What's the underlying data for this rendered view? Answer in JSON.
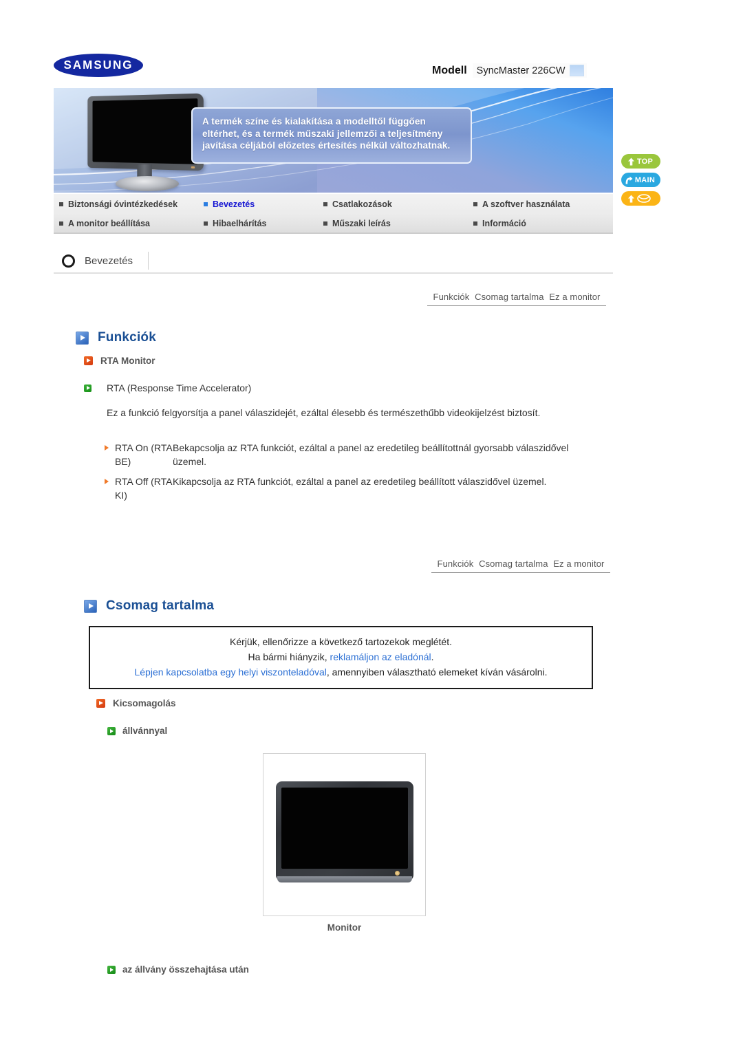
{
  "brand": {
    "logo_text": "SAMSUNG"
  },
  "model": {
    "label": "Modell",
    "value": "SyncMaster 226CW"
  },
  "banner": {
    "note": "A termék színe és kialakítása a modelltől függően eltérhet, és a termék műszaki jellemzői a teljesítmény javítása céljából előzetes értesítés nélkül változhatnak."
  },
  "side_buttons": [
    {
      "label": "TOP",
      "icon": "arrow-up-icon",
      "color": "#9ac63c"
    },
    {
      "label": "MAIN",
      "icon": "arrow-branch-icon",
      "color": "#2aa8e0"
    },
    {
      "label": "",
      "icon": "arrow-up-mail-icon",
      "color": "#fbb416"
    }
  ],
  "nav": {
    "items": [
      {
        "label": "Biztonsági óvintézkedések",
        "active": false
      },
      {
        "label": "Bevezetés",
        "active": true
      },
      {
        "label": "Csatlakozások",
        "active": false
      },
      {
        "label": "A szoftver használata",
        "active": false
      },
      {
        "label": "A monitor beállítása",
        "active": false
      },
      {
        "label": "Hibaelhárítás",
        "active": false
      },
      {
        "label": "Műszaki leírás",
        "active": false
      },
      {
        "label": "Információ",
        "active": false
      }
    ]
  },
  "section": {
    "title": "Bevezetés"
  },
  "subnav": {
    "items": [
      "Funkciók",
      "Csomag tartalma",
      "Ez a monitor"
    ]
  },
  "funkciok": {
    "heading": "Funkciók",
    "sub_heading": "RTA Monitor",
    "rta_title": "RTA (Response Time Accelerator)",
    "rta_paragraph": "Ez a funkció felgyorsítja a panel válaszidejét, ezáltal élesebb és természethűbb videokijelzést biztosít.",
    "rta_rows": [
      {
        "key": "RTA On (RTA BE)",
        "value": "Bekapcsolja az RTA funkciót, ezáltal a panel az eredetileg beállítottnál gyorsabb válaszidővel üzemel."
      },
      {
        "key": "RTA Off (RTA KI)",
        "value": "Kikapcsolja az RTA funkciót, ezáltal a panel az eredetileg beállított válaszidővel üzemel."
      }
    ]
  },
  "csomag": {
    "heading": "Csomag tartalma",
    "notice": {
      "line1": "Kérjük, ellenőrizze a következő tartozekok meglétét.",
      "line2_prefix": "Ha bármi hiányzik, ",
      "line2_link": "reklamáljon az eladónál",
      "line2_suffix": ".",
      "line3_link": "Lépjen kapcsolatba egy helyi viszonteladóval",
      "line3_suffix": ", amennyiben választható elemeket kíván vásárolni."
    },
    "kicsomagolas_heading": "Kicsomagolás",
    "allvannyal_label": "állvánnyal",
    "monitor_caption": "Monitor",
    "osszehajtas_label": "az állvány összehajtása után"
  },
  "colors": {
    "heading_blue": "#1a4f94",
    "link_blue": "#2b6fd4",
    "active_nav": "#1414d2",
    "accent_orange": "#f07a2a",
    "accent_green": "#2aa02a",
    "accent_red": "#d43a10",
    "samsung_blue": "#1428a0"
  }
}
